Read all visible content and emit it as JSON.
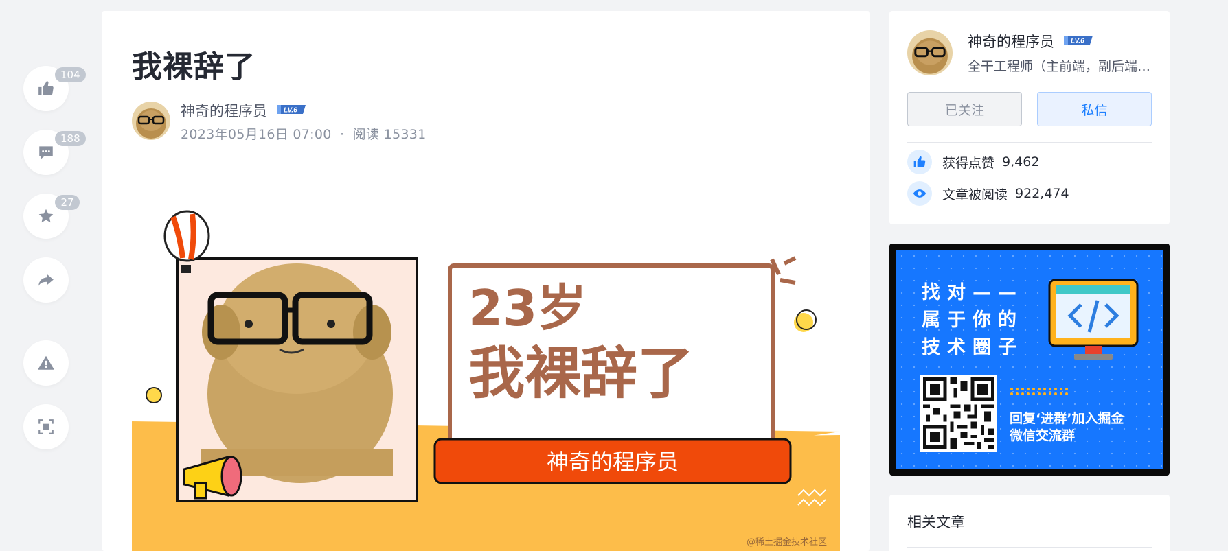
{
  "side_actions": {
    "like_count": "104",
    "comment_count": "188",
    "collect_count": "27"
  },
  "article": {
    "title": "我裸辞了",
    "author_name": "神奇的程序员",
    "author_level": "LV.6",
    "date": "2023年05月16日 07:00",
    "separator": "·",
    "read_label": "阅读",
    "read_count": "15331"
  },
  "banner": {
    "line1": "23岁",
    "line2": "我裸辞了",
    "author": "神奇的程序员",
    "watermark": "@稀土掘金技术社区"
  },
  "author_card": {
    "name": "神奇的程序员",
    "level": "LV.6",
    "description": "全干工程师（主前端，副后端…",
    "follow_label": "已关注",
    "message_label": "私信",
    "likes_label": "获得点赞",
    "likes_value": "9,462",
    "reads_label": "文章被阅读",
    "reads_value": "922,474"
  },
  "ad": {
    "line1": "找对——",
    "line2": "属于你的",
    "line3": "技术圈子",
    "sub1": "回复‘进群’加入掘金",
    "sub2": "微信交流群"
  },
  "related": {
    "title": "相关文章"
  },
  "colors": {
    "accent": "#1e80ff",
    "banner_orange": "#f04a0a",
    "banner_brown": "#a9674a",
    "banner_yellow": "#fdbd4a"
  }
}
